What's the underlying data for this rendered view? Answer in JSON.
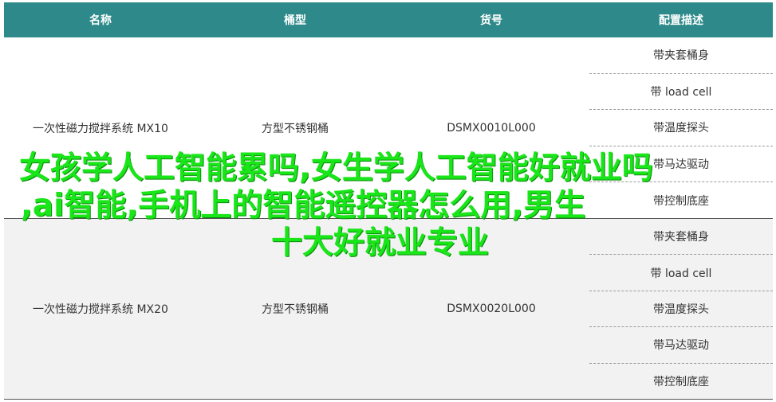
{
  "headers": [
    "名称",
    "桶型",
    "货号",
    "配置描述"
  ],
  "rows": [
    {
      "name": "一次性磁力搅拌系统 MX10",
      "bucket": "方型不锈钢桶",
      "sku": "DSMX0010L000",
      "configs": [
        "带夹套桶身",
        "带 load cell",
        "带温度探头",
        "带马达驱动",
        "带控制底座"
      ]
    },
    {
      "name": "一次性磁力搅拌系统 MX20",
      "bucket": "方型不锈钢桶",
      "sku": "DSMX0020L000",
      "configs": [
        "带夹套桶身",
        "带 load cell",
        "带温度探头",
        "带马达驱动",
        "带控制底座"
      ]
    }
  ],
  "overlay": {
    "line1": "女孩学人工智能累吗,女生学人工智能好就业吗",
    "line2": ",ai智能,手机上的智能遥控器怎么用,男生",
    "line3": "十大好就业专业"
  },
  "colors": {
    "header_bg": "#2e8a8a",
    "overlay_text": "#19e619",
    "alt_row_bg": "#f2f2f2"
  }
}
